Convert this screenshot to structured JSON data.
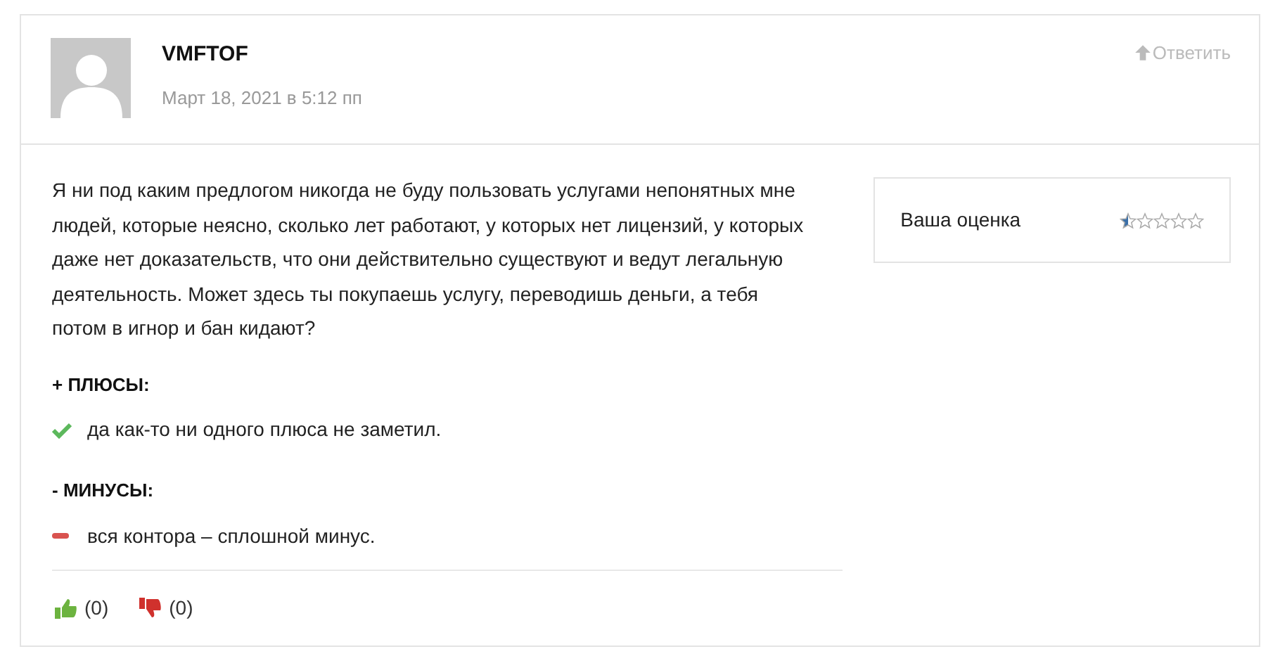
{
  "comment": {
    "author": "VMFTOF",
    "date": "Март 18, 2021 в 5:12 пп",
    "reply_label": "Ответить",
    "text": "Я ни под каким предлогом никогда не буду пользовать услугами непонятных мне людей, которые неясно, сколько лет работают, у которых нет лицензий, у которых даже нет доказательств, что они действительно существуют и ведут легальную деятельность. Может здесь ты покупаешь услугу, переводишь деньги, а тебя потом в игнор и бан кидают?",
    "pros_title": "+ ПЛЮСЫ:",
    "pros": [
      "да как-то ни одного плюса не заметил."
    ],
    "cons_title": "- МИНУСЫ:",
    "cons": [
      "вся контора – сплошной минус."
    ],
    "likes": "(0)",
    "dislikes": "(0)"
  },
  "rating": {
    "label": "Ваша оценка",
    "stars": 0.5
  }
}
